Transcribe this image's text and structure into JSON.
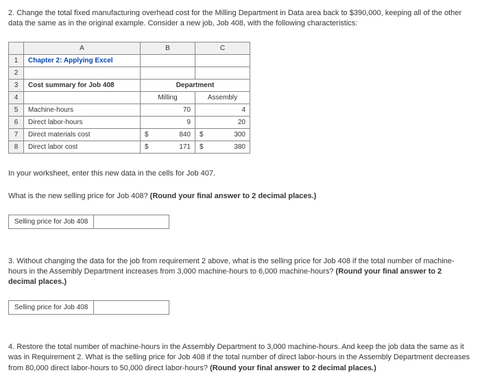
{
  "q2": {
    "prefix": "2. Change the total fixed manufacturing overhead cost for the Milling Department in Data area back to $390,000, keeping all of the other data the same as in the original example. Consider a new job, Job 408, with the following characteristics:"
  },
  "sheet": {
    "colA": "A",
    "colB": "B",
    "colC": "C",
    "r1": "1",
    "r2": "2",
    "r3": "3",
    "r4": "4",
    "r5": "5",
    "r6": "6",
    "r7": "7",
    "r8": "8",
    "chapter": "Chapter 2: Applying Excel",
    "costSummary": "Cost summary for Job 408",
    "department": "Department",
    "milling": "Milling",
    "assembly": "Assembly",
    "mh": "Machine-hours",
    "dlh": "Direct labor-hours",
    "dmc": "Direct materials cost",
    "dlc": "Direct labor cost",
    "v_mh_m": "70",
    "v_mh_a": "4",
    "v_dlh_m": "9",
    "v_dlh_a": "20",
    "v_dmc_m": "840",
    "v_dmc_a": "300",
    "v_dlc_m": "171",
    "v_dlc_a": "380",
    "curr": "$"
  },
  "q2b": {
    "line1": "In your worksheet, enter this new data in the cells for Job 407.",
    "line2a": "What is the new selling price for Job 408? ",
    "line2b": "(Round your final answer to 2 decimal places.)",
    "label": "Selling price for Job 408"
  },
  "q3": {
    "texta": "3. Without changing the data for the job from requirement 2 above, what is the selling price for Job 408 if the total number of machine-hours in the Assembly Department increases from 3,000 machine-hours to 6,000 machine-hours? ",
    "textb": "(Round your final answer to 2 decimal places.)",
    "label": "Selling price for Job 408"
  },
  "q4": {
    "texta": "4. Restore the total number of machine-hours in the Assembly Department to 3,000 machine-hours. And keep the job data the same as it was in Requirement 2. What is the selling price for Job 408 if the total number of direct labor-hours in the Assembly Department decreases from 80,000 direct labor-hours to 50,000 direct labor-hours? ",
    "textb": "(Round your final answer to 2 decimal places.)"
  }
}
